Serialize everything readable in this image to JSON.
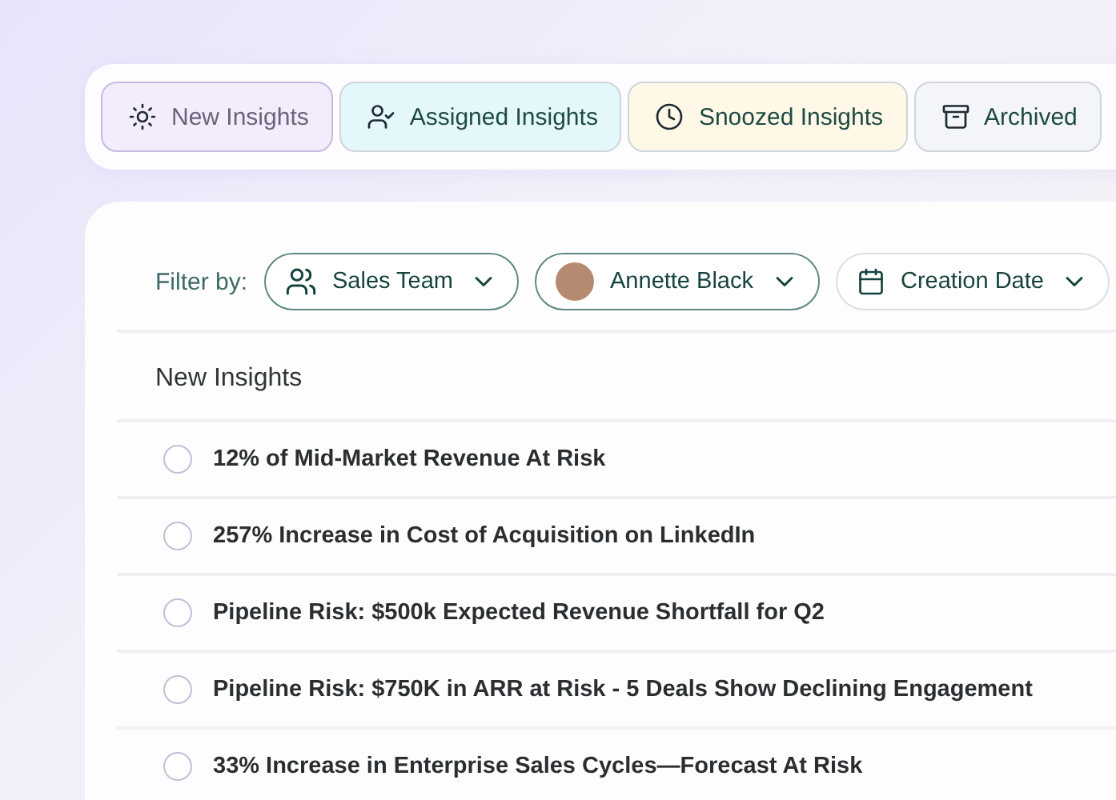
{
  "tabs": [
    {
      "label": "New Insights",
      "kind": "sun",
      "color": "#f3ecfd",
      "selected": true
    },
    {
      "label": "Assigned Insights",
      "kind": "user-check",
      "color": "#e4f7fb",
      "selected": false
    },
    {
      "label": "Snoozed Insights",
      "kind": "clock",
      "color": "#fff8e6",
      "selected": false
    },
    {
      "label": "Archived",
      "kind": "archive",
      "color": "#f3f5f8",
      "selected": false
    }
  ],
  "filters": {
    "label": "Filter by:",
    "items": [
      {
        "label": "Sales Team",
        "kind": "group",
        "active": true
      },
      {
        "label": "Annette Black",
        "kind": "avatar",
        "active": true
      },
      {
        "label": "Creation Date",
        "kind": "calendar",
        "active": false
      }
    ]
  },
  "list": {
    "title": "New Insights",
    "items": [
      {
        "text": "12% of Mid-Market Revenue At Risk",
        "checked": false
      },
      {
        "text": "257% Increase in Cost of Acquisition on LinkedIn",
        "checked": false
      },
      {
        "text": "Pipeline Risk: $500k Expected Revenue Shortfall for Q2",
        "checked": false
      },
      {
        "text": "Pipeline Risk: $750K in ARR at Risk - 5 Deals Show Declining Engagement",
        "checked": false
      },
      {
        "text": "33% Increase in Enterprise Sales Cycles—Forecast At Risk",
        "checked": false
      }
    ]
  }
}
